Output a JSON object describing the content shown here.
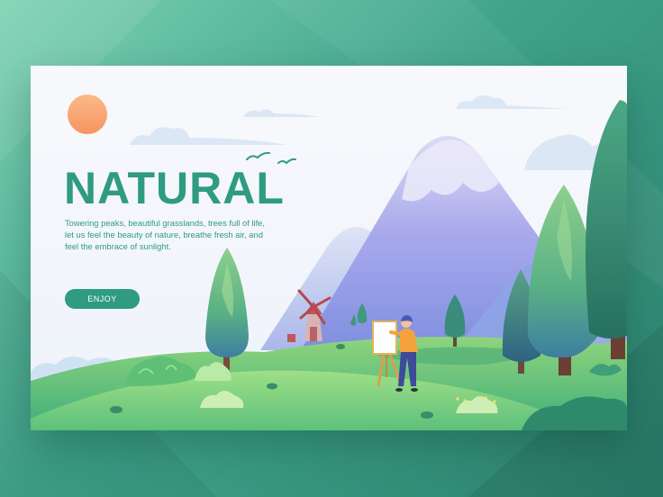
{
  "hero": {
    "title": "NATURAL",
    "description": "Towering peaks, beautiful grasslands, trees full of life, let us feel the beauty of nature, breathe fresh air, and feel the embrace of sunlight.",
    "cta_label": "ENJOY"
  },
  "colors": {
    "accent": "#2e9b82",
    "sun": "#f9a878",
    "background": "#3fa48a",
    "card": "#f6f8fb"
  },
  "illustration": {
    "icons": [
      "sun-icon",
      "cloud-icon",
      "bird-icon",
      "mountain-icon",
      "windmill-icon",
      "tree-icon",
      "painter-figure",
      "easel-icon",
      "bush-icon"
    ]
  }
}
